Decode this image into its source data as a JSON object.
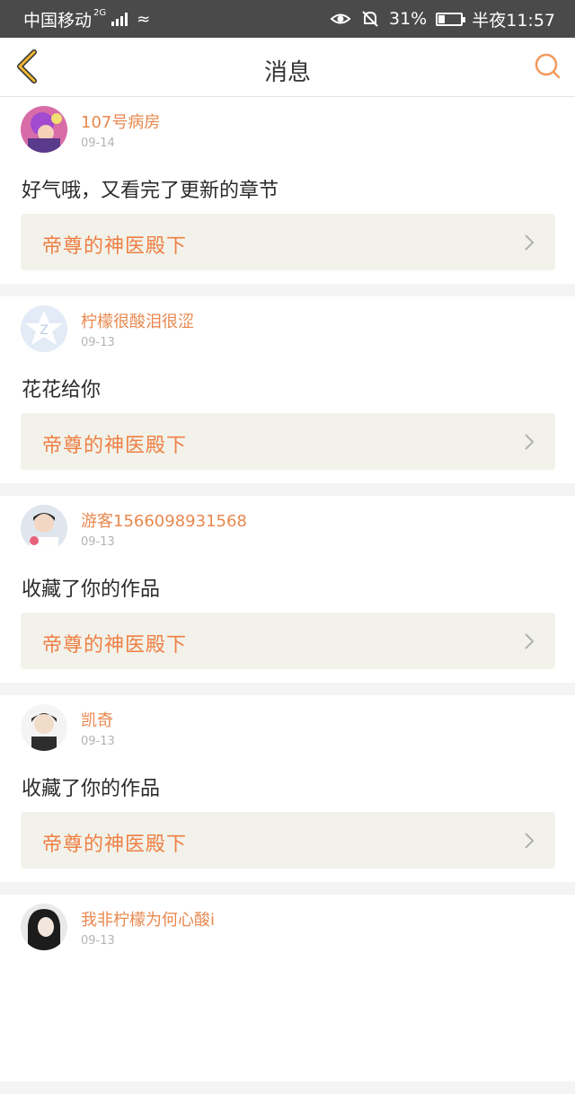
{
  "status_bar": {
    "carrier": "中国移动",
    "network": "2G",
    "battery": "31%",
    "battery_level": 0.31,
    "time": "半夜11:57"
  },
  "header": {
    "title": "消息",
    "back_icon": "chevron-left-icon",
    "search_icon": "search-icon"
  },
  "colors": {
    "accent": "#ef7f44",
    "username": "#e8884f",
    "back_arrow": "#f0b830",
    "link_box_bg": "#f2f2ea"
  },
  "messages": [
    {
      "user": "107号病房",
      "date": "09-14",
      "text": "好气哦，又看完了更新的章节",
      "book": "帝尊的神医殿下"
    },
    {
      "user": "柠檬很酸泪很涩",
      "date": "09-13",
      "text": "花花给你",
      "book": "帝尊的神医殿下"
    },
    {
      "user": "游客1566098931568",
      "date": "09-13",
      "text": "收藏了你的作品",
      "book": "帝尊的神医殿下"
    },
    {
      "user": "凯奇",
      "date": "09-13",
      "text": "收藏了你的作品",
      "book": "帝尊的神医殿下"
    },
    {
      "user": "我非柠檬为何心酸i",
      "date": "09-13",
      "text": "",
      "book": ""
    }
  ]
}
